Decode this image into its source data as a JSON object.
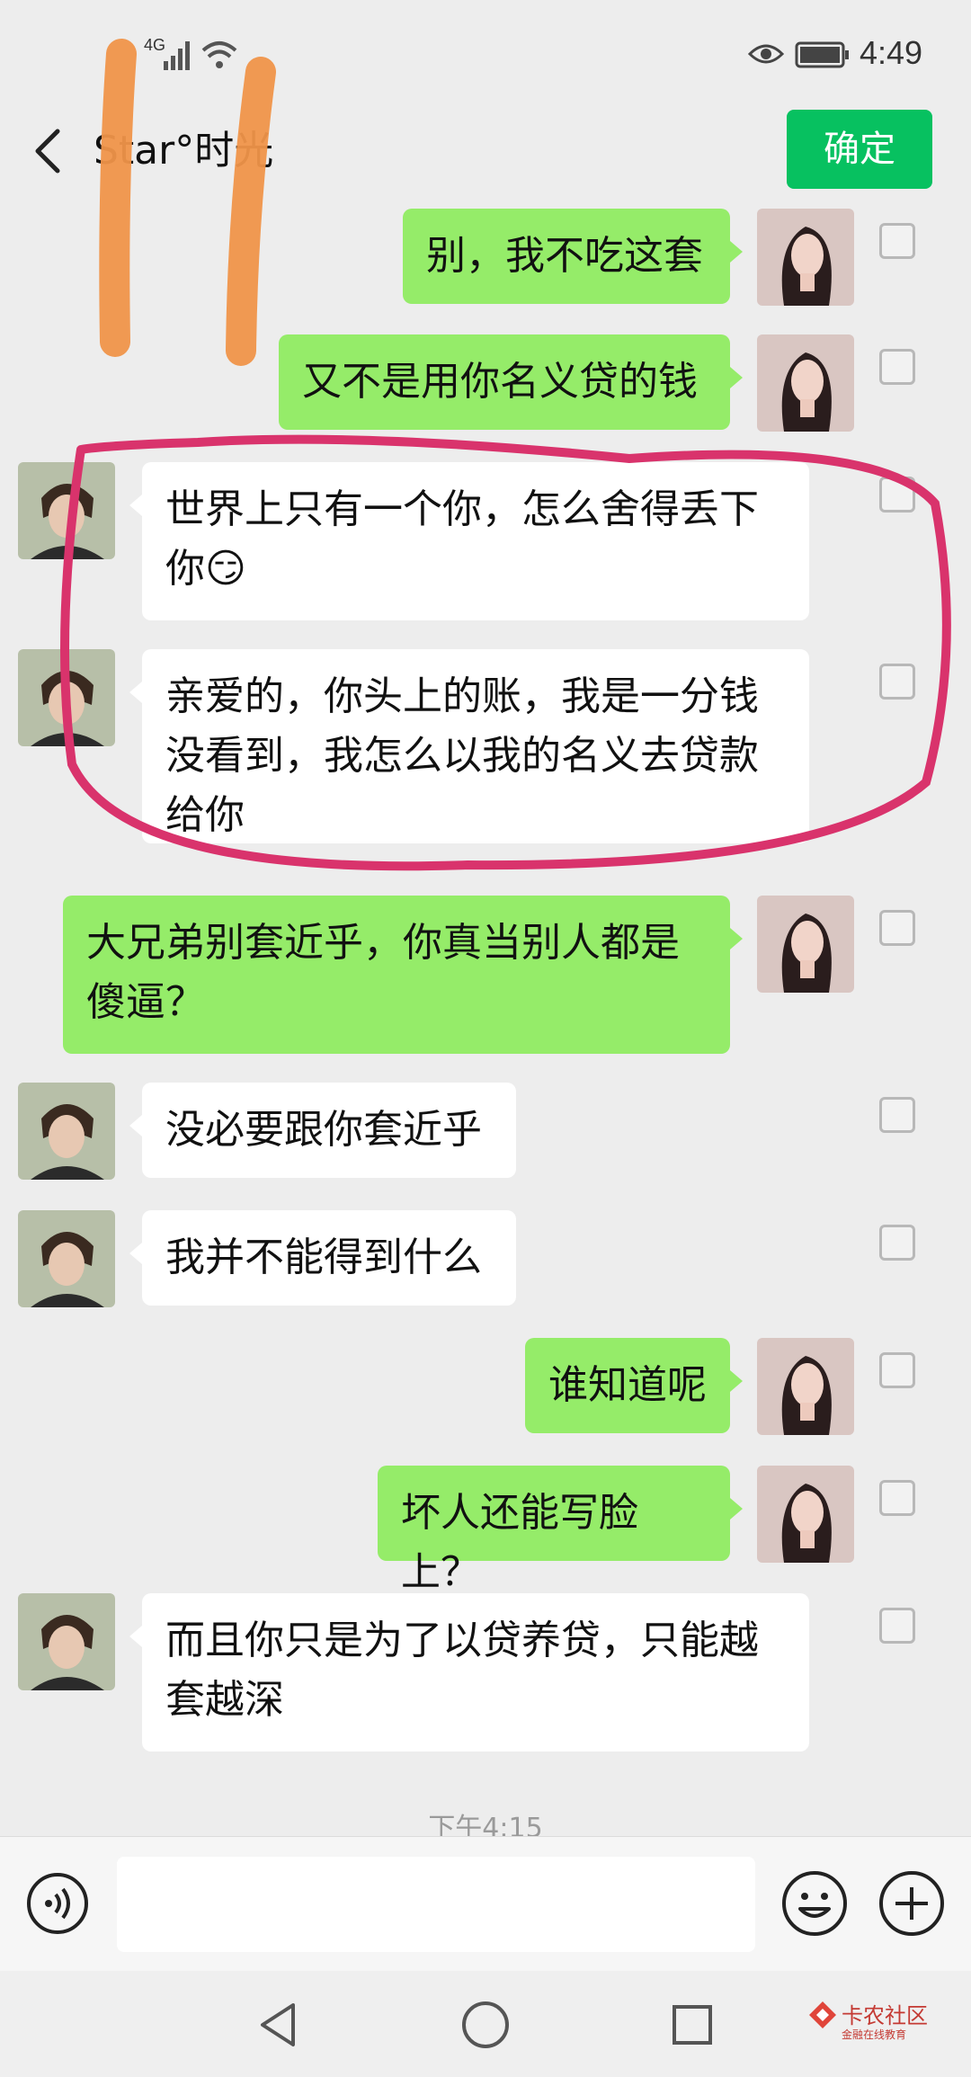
{
  "status_bar": {
    "network": "4G",
    "time": "4:49"
  },
  "header": {
    "title": "Star°时光",
    "confirm_label": "确定"
  },
  "messages": [
    {
      "side": "out",
      "text": "别，我不吃这套"
    },
    {
      "side": "out",
      "text": "又不是用你名义贷的钱"
    },
    {
      "side": "in",
      "text": "世界上只有一个你，怎么舍得丢下你😏"
    },
    {
      "side": "in",
      "text": "亲爱的，你头上的账，我是一分钱没看到，我怎么以我的名义去贷款给你"
    },
    {
      "side": "out",
      "text": "大兄弟别套近乎，你真当别人都是傻逼？"
    },
    {
      "side": "in",
      "text": "没必要跟你套近乎"
    },
    {
      "side": "in",
      "text": "我并不能得到什么"
    },
    {
      "side": "out",
      "text": "谁知道呢"
    },
    {
      "side": "out",
      "text": "坏人还能写脸上？"
    },
    {
      "side": "in",
      "text": "而且你只是为了以贷养贷，只能越套越深"
    }
  ],
  "timestamp": "下午4:15",
  "input": {
    "value": "",
    "placeholder": ""
  },
  "icons": {
    "back": "chevron-left-icon",
    "eye": "eye-icon",
    "battery": "battery-icon",
    "voice": "voice-icon",
    "emoji": "emoji-icon",
    "plus": "plus-icon"
  },
  "watermark": {
    "brand": "卡农社区",
    "tagline": "金融在线教育"
  },
  "colors": {
    "accent": "#07c160",
    "bubble_out": "#95ec69",
    "bubble_in": "#ffffff",
    "annotation": "#d9336c",
    "overlay_orange": "#f0954a"
  }
}
